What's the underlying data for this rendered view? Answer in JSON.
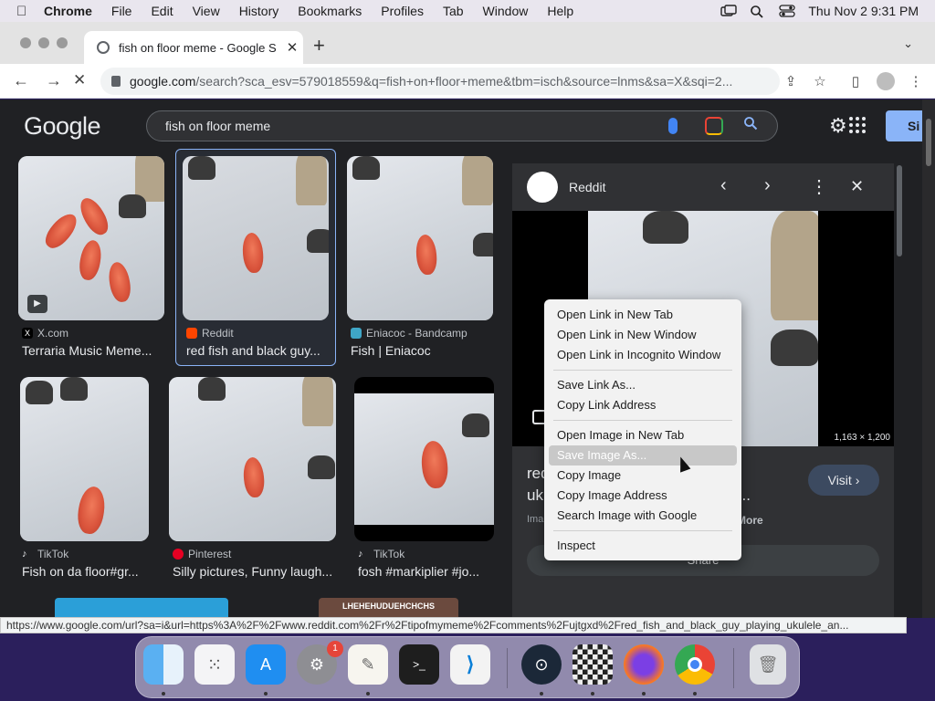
{
  "menubar": {
    "app_name": "Chrome",
    "items": [
      "File",
      "Edit",
      "View",
      "History",
      "Bookmarks",
      "Profiles",
      "Tab",
      "Window",
      "Help"
    ],
    "clock": "Thu Nov 2  9:31 PM"
  },
  "browser": {
    "tab_title": "fish on floor meme - Google S",
    "url_host": "google.com",
    "url_path": "/search?sca_esv=579018559&q=fish+on+floor+meme&tbm=isch&source=lnms&sa=X&sqi=2..."
  },
  "google": {
    "logo": "Google",
    "query": "fish on floor meme",
    "signin_label": "Si"
  },
  "results": [
    {
      "source": "X.com",
      "caption": "Terraria Music Meme..."
    },
    {
      "source": "Reddit",
      "caption": "red fish and black guy..."
    },
    {
      "source": "Eniacoc - Bandcamp",
      "caption": "Fish | Eniacoc"
    },
    {
      "source": "TikTok",
      "caption": "Fish on da floor#gr..."
    },
    {
      "source": "Pinterest",
      "caption": "Silly pictures, Funny laugh..."
    },
    {
      "source": "TikTok",
      "caption": "fosh #markiplier #jo..."
    }
  ],
  "bottom_thumb_text": "LHEHEHUDUEHCHCHS",
  "panel": {
    "source_name": "Reddit",
    "dimensions": "1,163 × 1,200",
    "title_line1": "red",
    "title_line2": "uk",
    "title_tail1": "g",
    "title_tail2": "ow...",
    "visit_label": "Visit",
    "images_note": "Ima",
    "more_label": "More",
    "share_label": "Share"
  },
  "context_menu": {
    "group1": [
      "Open Link in New Tab",
      "Open Link in New Window",
      "Open Link in Incognito Window"
    ],
    "group2": [
      "Save Link As...",
      "Copy Link Address"
    ],
    "group3": [
      "Open Image in New Tab",
      "Save Image As...",
      "Copy Image",
      "Copy Image Address",
      "Search Image with Google"
    ],
    "group4": [
      "Inspect"
    ],
    "highlighted": "Save Image As..."
  },
  "status_url": "https://www.google.com/url?sa=i&url=https%3A%2F%2Fwww.reddit.com%2Fr%2Ftipofmymeme%2Fcomments%2Fujtgxd%2Fred_fish_and_black_guy_playing_ukulele_an...",
  "dock": {
    "settings_badge": "1",
    "apps": [
      "finder-icon",
      "launchpad-icon",
      "app-store-icon",
      "system-settings-icon",
      "textedit-icon",
      "terminal-icon",
      "vscode-icon",
      "steam-icon",
      "chess-icon",
      "firefox-icon",
      "chrome-icon",
      "trash-icon"
    ]
  }
}
